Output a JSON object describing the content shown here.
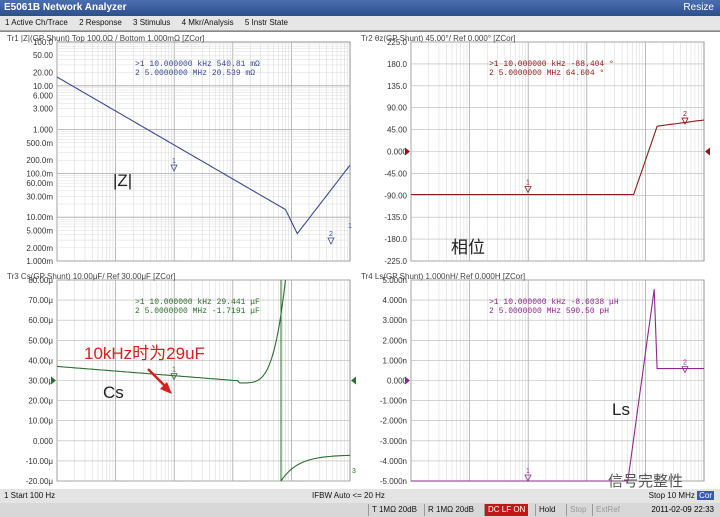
{
  "window": {
    "title": "E5061B Network Analyzer",
    "resize_label": "Resize"
  },
  "menu": [
    "1 Active Ch/Trace",
    "2 Response",
    "3 Stimulus",
    "4 Mkr/Analysis",
    "5 Instr State"
  ],
  "colors": {
    "tr1": "#3a4a90",
    "tr2": "#8a1a1a",
    "tr3": "#2e6e30",
    "tr4": "#8a2a8a",
    "annot_red": "#d42020"
  },
  "traces": {
    "tr1": {
      "header": "Tr1 |Z|(GP Shunt)  Top 100.0Ω / Bottom 1.000mΩ [ZCor]",
      "marker1": ">1  10.000000 kHz  540.81 mΩ",
      "marker2": " 2   5.0000000 MHz  20.539 mΩ",
      "annotation": "|Z|",
      "yticks": [
        "100.0",
        "50.00",
        "20.00",
        "10.00",
        "6.000",
        "3.000",
        "1.000",
        "500.0m",
        "200.0m",
        "100.0m",
        "60.00m",
        "30.00m",
        "10.00m",
        "5.000m",
        "2.000m",
        "1.000m"
      ]
    },
    "tr2": {
      "header": "Tr2 θz(GP Shunt)  45.00°/ Ref 0.000° [ZCor]",
      "marker1": ">1  10.000000 kHz  -88.404 °",
      "marker2": " 2   5.0000000 MHz  64.604 °",
      "annotation": "相位",
      "yticks": [
        "225.0",
        "180.0",
        "135.0",
        "90.00",
        "45.00",
        "0.000",
        "-45.00",
        "-90.00",
        "-135.0",
        "-180.0",
        "-225.0"
      ]
    },
    "tr3": {
      "header": "Tr3 Cs(GP Shunt)  10.00μF/ Ref 30.00μF [ZCor]",
      "marker1": ">1  10.000000 kHz  29.441 μF",
      "marker2": " 2   5.0000000 MHz  -1.7191 μF",
      "annotation": "Cs",
      "callout": "10kHz时为29uF",
      "yticks": [
        "80.00μ",
        "70.00μ",
        "60.00μ",
        "50.00μ",
        "40.00μ",
        "30.00μ",
        "20.00μ",
        "10.00μ",
        "0.000",
        "-10.00μ",
        "-20.00μ"
      ]
    },
    "tr4": {
      "header": "Tr4 Ls(GP Shunt)  1.000nH/ Ref 0.000H [ZCor]",
      "marker1": ">1  10.000000 kHz  -8.6038 μH",
      "marker2": " 2   5.0000000 MHz  590.50 pH",
      "annotation": "Ls",
      "yticks": [
        "5.000n",
        "4.000n",
        "3.000n",
        "2.000n",
        "1.000n",
        "0.000",
        "-1.000n",
        "-2.000n",
        "-3.000n",
        "-4.000n",
        "-5.000n"
      ]
    }
  },
  "status": {
    "start": "1 Start 100 Hz",
    "ifbw": "IFBW Auto <= 20 Hz",
    "stop": "Stop 10 MHz",
    "cor": "Cor"
  },
  "info": {
    "t": "T 1MΩ 20dB",
    "r": "R 1MΩ 20dB",
    "dc": "DC LF ON",
    "hold": "Hold",
    "stop": "Stop",
    "extref": "ExtRef",
    "timestamp": "2011-02-09 22:33"
  },
  "watermark": "信号完整性"
}
